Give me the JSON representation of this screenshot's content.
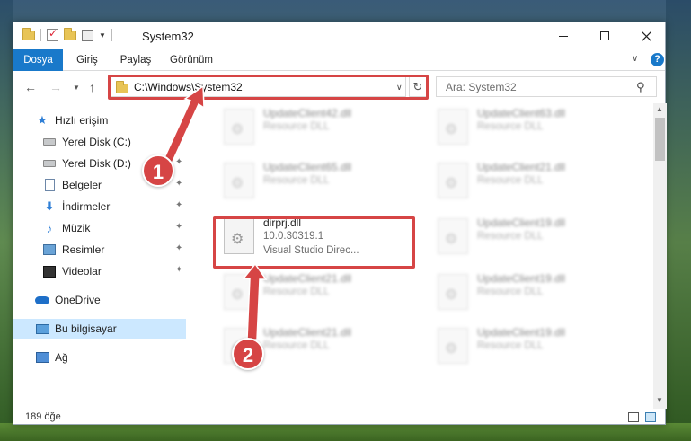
{
  "window": {
    "title": "System32",
    "controls": {
      "minimize": "minimize",
      "maximize": "maximize",
      "close": "close"
    }
  },
  "ribbon": {
    "tabs": [
      "Dosya",
      "Giriş",
      "Paylaş",
      "Görünüm"
    ],
    "help_label": "?"
  },
  "address": {
    "path": "C:\\Windows\\System32",
    "search_placeholder": "Ara: System32"
  },
  "sidebar": {
    "items": [
      {
        "label": "Hızlı erişim",
        "icon": "star-icon"
      },
      {
        "label": "Yerel Disk (C:)",
        "icon": "disk-icon"
      },
      {
        "label": "Yerel Disk (D:)",
        "icon": "disk-icon"
      },
      {
        "label": "Belgeler",
        "icon": "documents-icon"
      },
      {
        "label": "İndirmeler",
        "icon": "download-icon"
      },
      {
        "label": "Müzik",
        "icon": "music-icon"
      },
      {
        "label": "Resimler",
        "icon": "pictures-icon"
      },
      {
        "label": "Videolar",
        "icon": "videos-icon"
      },
      {
        "label": "OneDrive",
        "icon": "cloud-icon"
      },
      {
        "label": "Bu bilgisayar",
        "icon": "computer-icon"
      },
      {
        "label": "Ağ",
        "icon": "network-icon"
      }
    ]
  },
  "files": [
    {
      "name": "UpdateClient42.dll",
      "sub1": "Resource DLL",
      "sub2": ""
    },
    {
      "name": "UpdateClient63.dll",
      "sub1": "Resource DLL",
      "sub2": ""
    },
    {
      "name": "UpdateClient65.dll",
      "sub1": "Resource DLL",
      "sub2": ""
    },
    {
      "name": "UpdateClient21.dll",
      "sub1": "Resource DLL",
      "sub2": ""
    },
    {
      "name": "dirprj.dll",
      "sub1": "10.0.30319.1",
      "sub2": "Visual Studio Direc..."
    },
    {
      "name": "UpdateClient19.dll",
      "sub1": "Resource DLL",
      "sub2": ""
    },
    {
      "name": "UpdateClient21.dll",
      "sub1": "Resource DLL",
      "sub2": ""
    },
    {
      "name": "UpdateClient19.dll",
      "sub1": "Resource DLL",
      "sub2": ""
    },
    {
      "name": "UpdateClient21.dll",
      "sub1": "Resource DLL",
      "sub2": ""
    },
    {
      "name": "UpdateClient19.dll",
      "sub1": "Resource DLL",
      "sub2": ""
    }
  ],
  "status": {
    "item_count": "189 öğe"
  },
  "annotations": {
    "step1": "1",
    "step2": "2"
  },
  "colors": {
    "accent": "#1979ca",
    "highlight": "#d64545",
    "selected": "#cce8ff"
  }
}
